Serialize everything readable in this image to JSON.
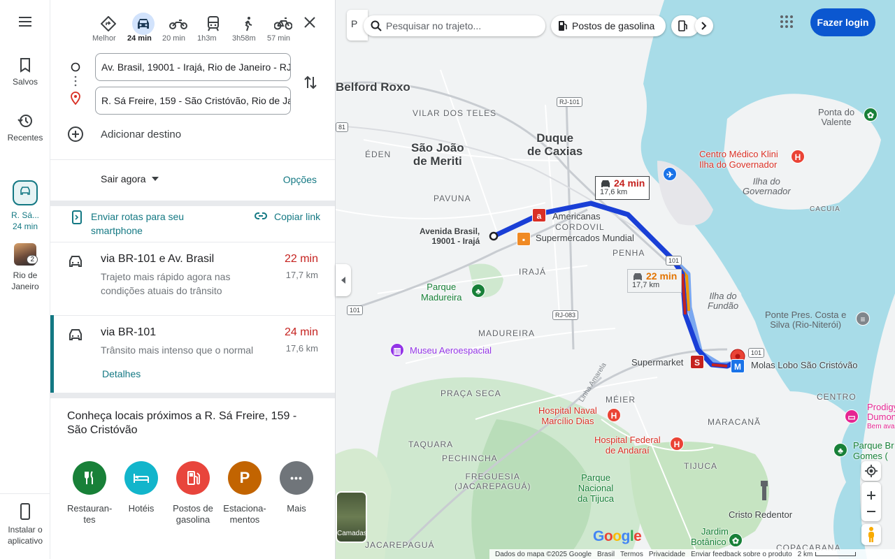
{
  "rail": {
    "saved": "Salvos",
    "recent": "Recentes",
    "route_thumb_line1": "R. Sá...",
    "route_thumb_line2": "24 min",
    "rio_count": "2",
    "rio_line1": "Rio de",
    "rio_line2": "Janeiro",
    "install_line1": "Instalar o",
    "install_line2": "aplicativo"
  },
  "modes": [
    {
      "label": "Melhor",
      "icon": "diamond-route-icon"
    },
    {
      "label": "24 min",
      "icon": "car-icon",
      "active": true
    },
    {
      "label": "20 min",
      "icon": "motorcycle-icon"
    },
    {
      "label": "1h3m",
      "icon": "transit-icon"
    },
    {
      "label": "3h58m",
      "icon": "walk-icon"
    },
    {
      "label": "57 min",
      "icon": "bike-icon"
    }
  ],
  "directions": {
    "origin": "Av. Brasil, 19001 - Irajá, Rio de Janeiro - RJ",
    "destination": "R. Sá Freire, 159 - São Cristóvão, Rio de Janeiro - RJ",
    "add_destination": "Adicionar destino",
    "depart": "Sair agora",
    "options": "Opções",
    "send_to_phone": "Enviar rotas para seu smartphone",
    "copy_link": "Copiar link"
  },
  "routes": [
    {
      "name": "via BR-101 e Av. Brasil",
      "desc": "Trajeto mais rápido agora nas condições atuais do trânsito",
      "time": "22 min",
      "dist": "17,7 km"
    },
    {
      "name": "via BR-101",
      "desc": "Trânsito mais intenso que o normal",
      "time": "24 min",
      "dist": "17,6 km",
      "details": "Detalhes",
      "selected": true
    }
  ],
  "nearby": {
    "title": "Conheça locais próximos a R. Sá Freire, 159 - São Cristóvão",
    "categories": [
      {
        "label": "Restauran-tes",
        "icon": "fork-knife-icon",
        "color": "#188038"
      },
      {
        "label": "Hotéis",
        "icon": "bed-icon",
        "color": "#12b5cb"
      },
      {
        "label": "Postos de gasolina",
        "icon": "gas-pump-icon",
        "color": "#d93025"
      },
      {
        "label": "Estaciona-mentos",
        "icon": "parking-icon",
        "glyph": "P",
        "color": "#c26401"
      },
      {
        "label": "Mais",
        "icon": "more-icon",
        "glyph": "•••",
        "color": "#70757a"
      }
    ]
  },
  "map": {
    "search_placeholder": "Pesquisar no trajeto...",
    "chip_gas": "Postos de gasolina",
    "login": "Fazer login",
    "layers": "Camadas",
    "google": "Google",
    "callout_selected": {
      "time": "24 min",
      "dist": "17,6 km"
    },
    "callout_alt": {
      "time": "22 min",
      "dist": "17,7 km"
    },
    "origin_label_1": "Avenida Brasil,",
    "origin_label_2": "19001 - Irajá",
    "labels": {
      "belford_roxo": "Belford Roxo",
      "vilar_dos_teles": "VILAR DOS TELES",
      "duque_1": "Duque",
      "duque_2": "de Caxias",
      "sao_joao_1": "São João",
      "sao_joao_2": "de Meriti",
      "eden": "ÉDEN",
      "pavuna": "PAVUNA",
      "cordovil": "CORDOVIL",
      "penha": "PENHA",
      "iraja": "IRAJÁ",
      "madureira": "MADUREIRA",
      "praca_seca": "PRAÇA SECA",
      "meier": "MÉIER",
      "maracana": "MARACANÃ",
      "tijuca": "TIJUCA",
      "taquara": "TAQUARA",
      "pechincha": "PECHINCHA",
      "freguesia_1": "FREGUESIA",
      "freguesia_2": "(JACAREPAGUÁ)",
      "jacarepagua": "JACAREPAGUÁ",
      "centro": "CENTRO",
      "cacuia": "CACUIA",
      "copacabana": "COPACABANA",
      "ilha_gov_1": "Ilha do",
      "ilha_gov_2": "Governador",
      "ilha_fundao_1": "Ilha do",
      "ilha_fundao_2": "Fundão",
      "ponta_valente_1": "Ponta do",
      "ponta_valente_2": "Valente",
      "klini_1": "Centro Médico Klini",
      "klini_2": "Ilha do Governador",
      "americanas": "Americanas",
      "mundial": "Supermercados Mundial",
      "parque_madureira_1": "Parque",
      "parque_madureira_2": "Madureira",
      "museu": "Museu Aeroespacial",
      "supermarket": "Supermarket",
      "molas": "Molas Lobo São Cristóvão",
      "ponte_1": "Ponte Pres. Costa e",
      "ponte_2": "Silva (Rio-Niterói)",
      "hosp_naval_1": "Hospital Naval",
      "hosp_naval_2": "Marcílio Dias",
      "hosp_fed_1": "Hospital Federal",
      "hosp_fed_2": "de Andaraí",
      "parque_tijuca_1": "Parque",
      "parque_tijuca_2": "Nacional",
      "parque_tijuca_3": "da Tijuca",
      "cristo": "Cristo Redentor",
      "jardim_1": "Jardim",
      "jardim_2": "Botânico do",
      "prodigy_1": "Prodigy",
      "prodigy_2": "Dumon",
      "prodigy_3": "Bem ava",
      "parque_br_1": "Parque Br",
      "parque_br_2": "Gomes (",
      "linha_amarela": "Linha Amarela",
      "rj101": "RJ-101",
      "rj083": "RJ-083",
      "s101a": "101",
      "s101b": "101",
      "s101c": "101",
      "s81": "81"
    },
    "footer": {
      "data": "Dados do mapa ©2025 Google",
      "country": "Brasil",
      "terms": "Termos",
      "privacy": "Privacidade",
      "feedback": "Enviar feedback sobre o produto",
      "scale": "2 km"
    }
  },
  "colors": {
    "route_selected": "#1a3fd6",
    "route_alt": "#7aa7f0",
    "accent": "#137883",
    "traffic_red": "#c5221f"
  }
}
